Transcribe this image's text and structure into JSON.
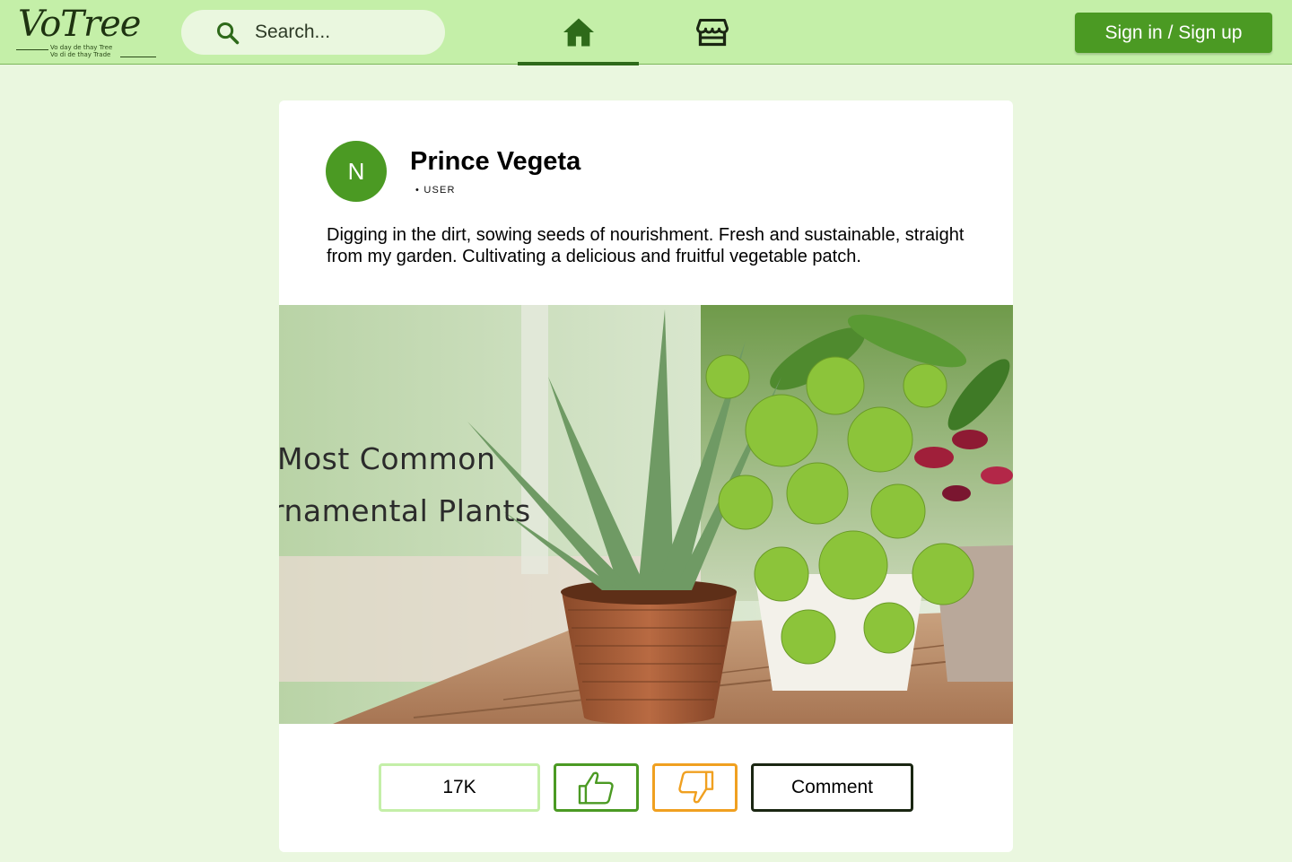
{
  "header": {
    "logo_text": "VoTree",
    "logo_tagline_1": "Vo day de thay Tree",
    "logo_tagline_2": "Vo di de thay Trade",
    "search_placeholder": "Search...",
    "signin_label": "Sign in / Sign up",
    "nav": [
      {
        "icon": "home-icon",
        "active": true
      },
      {
        "icon": "store-icon",
        "active": false
      }
    ]
  },
  "post": {
    "author": {
      "initial": "N",
      "name": "Prince Vegeta",
      "role": "USER"
    },
    "text": "Digging in the dirt, sowing seeds of nourishment. Fresh and sustainable, straight from my garden. Cultivating a delicious and fruitful vegetable patch.",
    "image_caption_1": "Most Common",
    "image_caption_2": "rnamental Plants",
    "actions": {
      "count": "17K",
      "comment_label": "Comment"
    }
  },
  "colors": {
    "header_bg": "#c4efa8",
    "page_bg": "#eaf7df",
    "accent": "#4b9a23",
    "dislike": "#f0a020"
  }
}
